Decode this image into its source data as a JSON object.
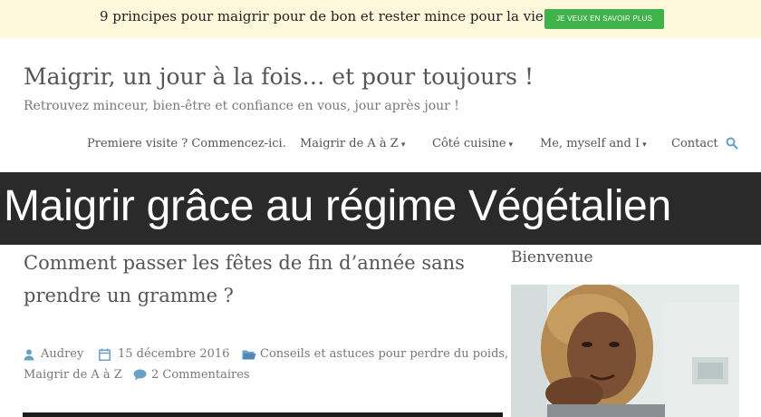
{
  "topbar": {
    "text": "9 principes pour maigrir pour de bon et rester mince pour la vie !",
    "button_label": "JE VEUX EN SAVOIR PLUS",
    "button_color": "#3fb24a"
  },
  "site": {
    "title": "Maigrir, un jour à la fois… et pour toujours !",
    "description": "Retrouvez minceur, bien-être et confiance en vous, jour après jour !"
  },
  "nav": {
    "items": [
      {
        "label": "Premiere visite ? Commencez-ici.",
        "dropdown": false
      },
      {
        "label": "Maigrir de A à Z",
        "dropdown": true
      },
      {
        "label": "Côté cuisine",
        "dropdown": true
      },
      {
        "label": "Me, myself and I",
        "dropdown": true
      },
      {
        "label": "Contact",
        "dropdown": false
      }
    ],
    "caret": "▾",
    "search_icon": "search-icon"
  },
  "banner": {
    "title": "Maigrir grâce au régime Végétalien"
  },
  "post": {
    "title": "Comment passer les fêtes de fin d’année sans prendre un gramme ?",
    "author": "Audrey",
    "date": "15 décembre 2016",
    "categories_line1": "Conseils et astuces pour perdre du poids,",
    "categories_line2": "Maigrir de A à Z",
    "comments": "2 Commentaires"
  },
  "sidebar": {
    "title": "Bienvenue"
  },
  "colors": {
    "accent": "#6aa0c8",
    "banner_bg": "#2a2a2a",
    "topbar_bg": "#fdf7dc"
  }
}
